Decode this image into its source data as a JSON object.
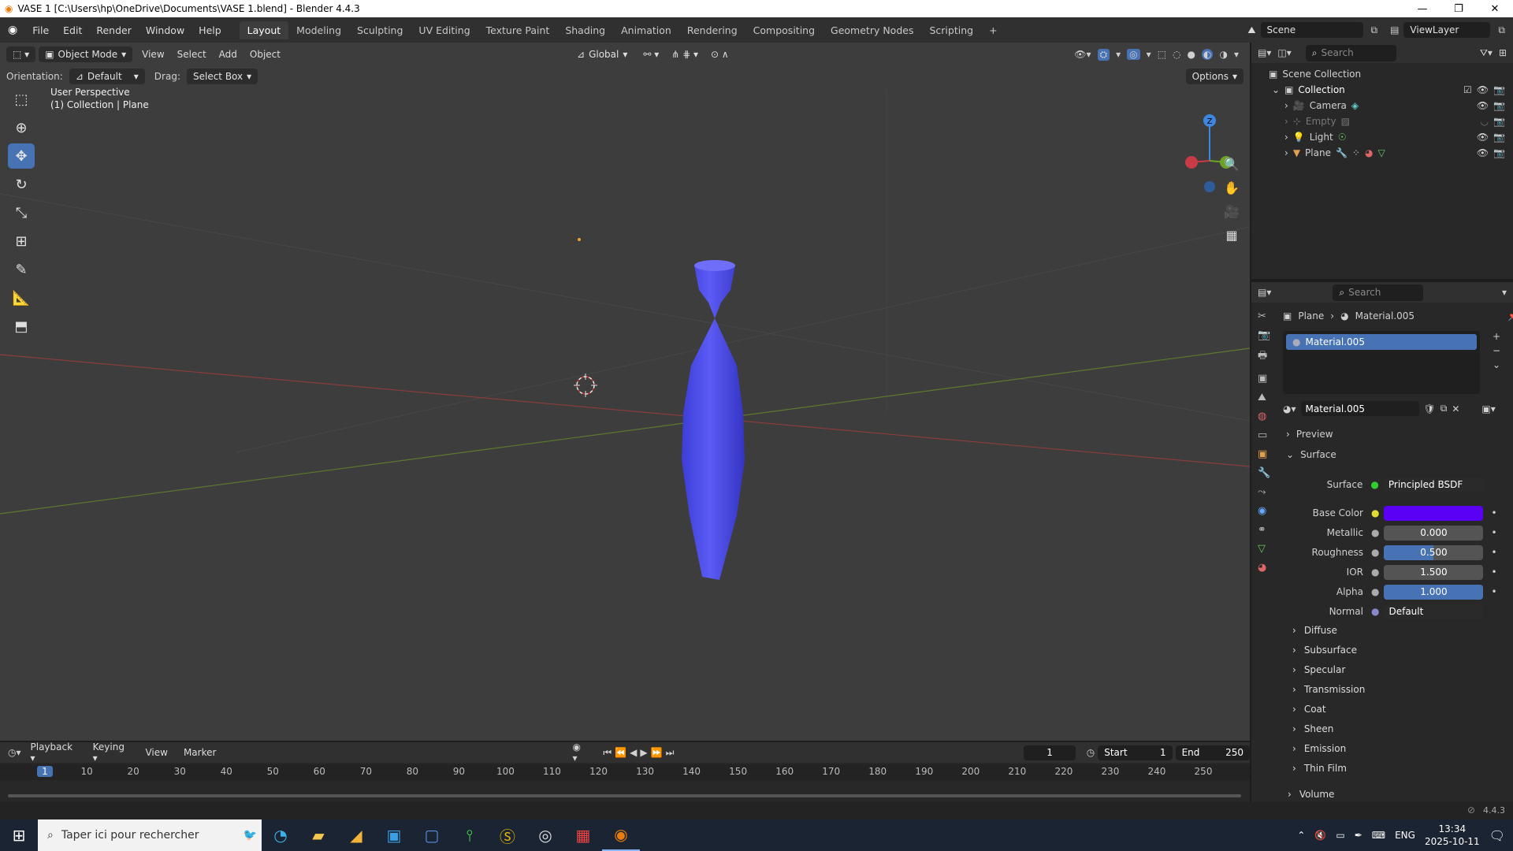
{
  "window": {
    "title": "VASE 1 [C:\\Users\\hp\\OneDrive\\Documents\\VASE 1.blend] - Blender 4.4.3"
  },
  "menu": [
    "File",
    "Edit",
    "Render",
    "Window",
    "Help"
  ],
  "workspaces": [
    "Layout",
    "Modeling",
    "Sculpting",
    "UV Editing",
    "Texture Paint",
    "Shading",
    "Animation",
    "Rendering",
    "Compositing",
    "Geometry Nodes",
    "Scripting"
  ],
  "scene": {
    "scene_label": "Scene",
    "viewlayer_label": "ViewLayer"
  },
  "viewport": {
    "mode": "Object Mode",
    "menus": [
      "View",
      "Select",
      "Add",
      "Object"
    ],
    "transform": "Global",
    "orientation_label": "Orientation:",
    "orientation_value": "Default",
    "drag_label": "Drag:",
    "drag_value": "Select Box",
    "options_label": "Options",
    "perspective": "User Perspective",
    "collection_info": "(1) Collection | Plane",
    "gizmo_z": "Z",
    "accent": "#4772b3",
    "object_color": "#5151ee"
  },
  "outliner": {
    "search_placeholder": "Search",
    "root": "Scene Collection",
    "collection": "Collection",
    "items": [
      {
        "name": "Camera",
        "dimmed": false
      },
      {
        "name": "Empty",
        "dimmed": true
      },
      {
        "name": "Light",
        "dimmed": false
      },
      {
        "name": "Plane",
        "dimmed": false
      }
    ]
  },
  "properties": {
    "search_placeholder": "Search",
    "breadcrumb_object": "Plane",
    "breadcrumb_material": "Material.005",
    "slot_name": "Material.005",
    "material_name": "Material.005",
    "preview_label": "Preview",
    "surface_panel": "Surface",
    "surface_label": "Surface",
    "surface_value": "Principled BSDF",
    "base_color_label": "Base Color",
    "base_color": "#5a00f5",
    "metallic_label": "Metallic",
    "metallic_value": "0.000",
    "roughness_label": "Roughness",
    "roughness_value": "0.500",
    "roughness_fraction": 0.5,
    "ior_label": "IOR",
    "ior_value": "1.500",
    "alpha_label": "Alpha",
    "alpha_value": "1.000",
    "alpha_fraction": 1.0,
    "normal_label": "Normal",
    "normal_value": "Default",
    "subpanels": [
      "Diffuse",
      "Subsurface",
      "Specular",
      "Transmission",
      "Coat",
      "Sheen",
      "Emission",
      "Thin Film"
    ],
    "volume_label": "Volume"
  },
  "timeline": {
    "menus": [
      "Playback",
      "Keying",
      "View",
      "Marker"
    ],
    "current_frame": "1",
    "start_label": "Start",
    "start_value": "1",
    "end_label": "End",
    "end_value": "250",
    "ruler": [
      "1",
      "10",
      "20",
      "30",
      "40",
      "50",
      "60",
      "70",
      "80",
      "90",
      "100",
      "110",
      "120",
      "130",
      "140",
      "150",
      "160",
      "170",
      "180",
      "190",
      "200",
      "210",
      "220",
      "230",
      "240",
      "250"
    ]
  },
  "status": {
    "version": "4.4.3"
  },
  "taskbar": {
    "search_placeholder": "Taper ici pour rechercher",
    "language": "ENG",
    "time": "13:34",
    "date": "2025-10-11"
  }
}
